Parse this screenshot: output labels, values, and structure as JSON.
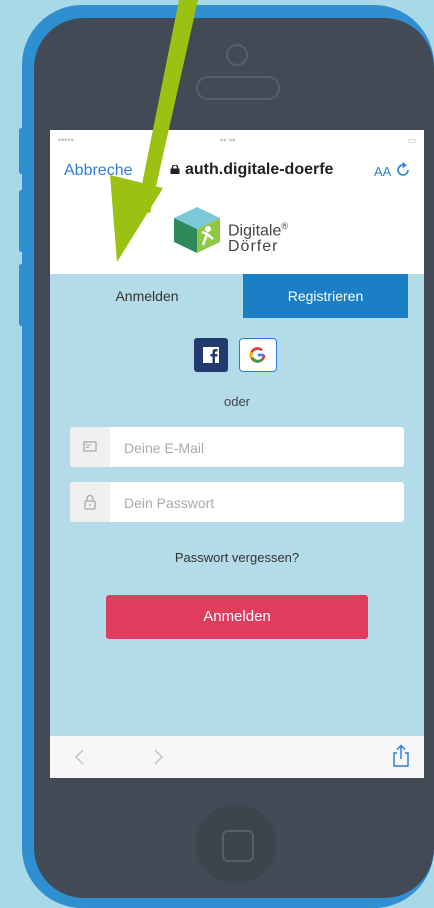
{
  "browser": {
    "cancel_label": "Abbreche",
    "domain": "auth.digitale-doerfe",
    "text_size_label": "AA"
  },
  "brand": {
    "line1": "Digitale",
    "registered": "®",
    "line2": "Dörfer"
  },
  "tabs": {
    "login": "Anmelden",
    "register": "Registrieren"
  },
  "form": {
    "or_text": "oder",
    "email_placeholder": "Deine E-Mail",
    "password_placeholder": "Dein Passwort",
    "forgot_label": "Passwort vergessen?",
    "submit_label": "Anmelden"
  },
  "colors": {
    "background": "#a9d8e6",
    "phone_body": "#2f8fd0",
    "arrow": "#9bc213",
    "register_tab": "#1a7fc4",
    "submit_button": "#e03c5e",
    "facebook": "#233a6e"
  },
  "icons": [
    "lock-icon",
    "reload-icon",
    "facebook-icon",
    "google-icon",
    "email-icon",
    "lock-icon",
    "back-icon",
    "forward-icon",
    "share-icon",
    "logo-icon"
  ]
}
